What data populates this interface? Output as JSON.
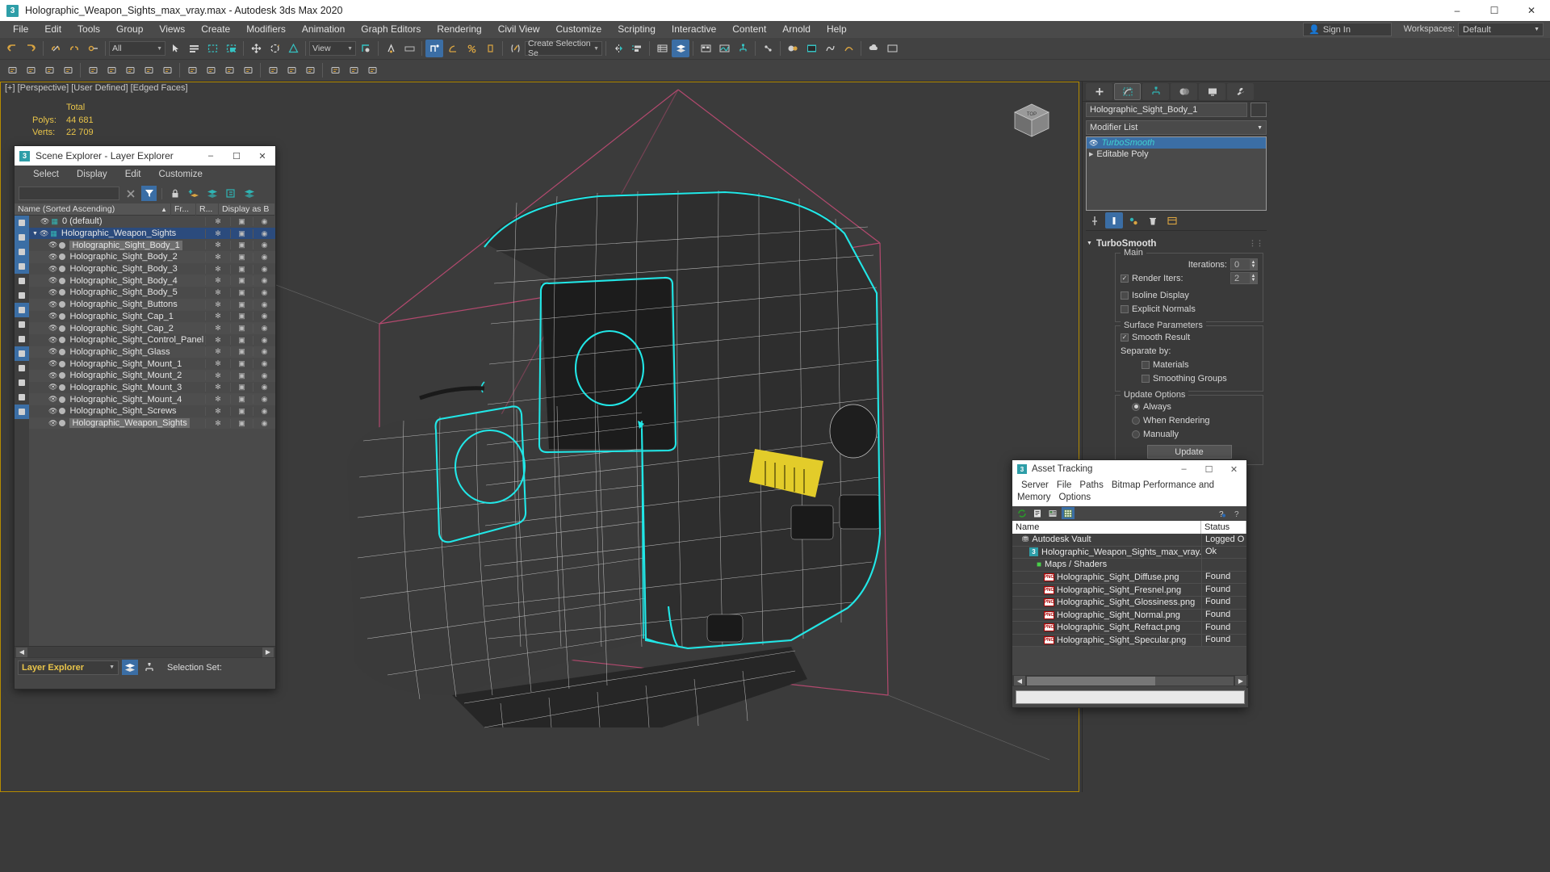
{
  "title_bar": {
    "logo": "max-logo-icon",
    "title": "Holographic_Weapon_Sights_max_vray.max - Autodesk 3ds Max 2020",
    "minimize": "–",
    "maximize": "☐",
    "close": "✕"
  },
  "menu_bar": {
    "items": [
      "File",
      "Edit",
      "Tools",
      "Group",
      "Views",
      "Create",
      "Modifiers",
      "Animation",
      "Graph Editors",
      "Rendering",
      "Civil View",
      "Customize",
      "Scripting",
      "Interactive",
      "Content",
      "Arnold",
      "Help"
    ],
    "sign_in": "Sign In",
    "workspaces_label": "Workspaces:",
    "workspace_value": "Default"
  },
  "toolbar": {
    "selection_filter": "All",
    "view_combo": "View",
    "named_selection_set": "Create Selection Se",
    "icons_row1": [
      "undo-icon",
      "redo-icon",
      "select-link-icon",
      "unlink-icon",
      "bind-space-warp-icon",
      "filter-combo",
      "select-object-icon",
      "select-by-name-icon",
      "rect-select-icon",
      "window-crossing-icon",
      "select-move-icon",
      "select-rotate-icon",
      "select-scale-icon",
      "ref-coord-combo",
      "use-pivot-center-icon",
      "select-and-manipulate-icon",
      "snap-toggle-icon",
      "angle-snap-icon",
      "percent-snap-icon",
      "spinner-snap-icon",
      "named-selection-icon",
      "mirror-icon",
      "align-icon",
      "layer-explorer-icon",
      "scene-explorer-icon",
      "ribbon-icon",
      "curve-editor-icon",
      "schematic-view-icon",
      "project-folder-icon",
      "material-editor-icon",
      "render-setup-icon",
      "render-frame-icon",
      "render-production-icon"
    ],
    "icons_row2": [
      "select-icon",
      "window-crossing-icon",
      "paint-select-icon",
      "named-sel-icon",
      "mirror-icon",
      "align-icon",
      "quick-align-icon",
      "spacing-icon",
      "clone-icon",
      "array-icon",
      "snapshot-icon",
      "normal-align-icon",
      "place-highlight-icon",
      "align-camera-icon",
      "align-view-icon",
      "quick-render-icon",
      "render-in-cloud-icon",
      "open-ui-icon",
      "help-icon"
    ]
  },
  "viewport": {
    "label": "[+] [Perspective] [User Defined] [Edged Faces]",
    "stats": {
      "header": "Total",
      "polys_label": "Polys:",
      "polys_value": "44 681",
      "verts_label": "Verts:",
      "verts_value": "22 709"
    },
    "viewcube": "view-cube-icon",
    "selection_highlight_color": "#21e7e7",
    "grid_color": "#c84c78",
    "model": "holographic-weapon-sight-3d-model"
  },
  "scene_explorer": {
    "window_title": "Scene Explorer - Layer Explorer",
    "logo": "max-logo-icon",
    "window_controls": {
      "minimize": "–",
      "maximize": "☐",
      "close": "✕"
    },
    "menus": [
      "Select",
      "Display",
      "Edit",
      "Customize"
    ],
    "search_value": "",
    "toolbar_icons": [
      "clear-search-icon",
      "filter-icon",
      "lock-icon",
      "add-layer-icon",
      "select-highlighted-layer-icon",
      "layer-hierarchy-icon",
      "layers-icon"
    ],
    "left_rail_icons": [
      "geometry-filter-icon",
      "shapes-filter-icon",
      "lights-filter-icon",
      "cameras-filter-icon",
      "helpers-filter-icon",
      "space-warps-filter-icon",
      "bones-filter-icon",
      "groups-filter-icon",
      "xrefs-filter-icon",
      "all-filter-icon",
      "particle-filter-icon",
      "freeze-filter-icon",
      "hidden-filter-icon",
      "visible-filter-icon"
    ],
    "columns": [
      {
        "label": "Name (Sorted Ascending)",
        "sort": "▲"
      },
      {
        "label": "Fr..."
      },
      {
        "label": "R..."
      },
      {
        "label": "Display as B"
      }
    ],
    "rows": [
      {
        "name": "0 (default)",
        "type": "layer",
        "depth": 1,
        "expander": "",
        "selected": false,
        "highlighted": false
      },
      {
        "name": "Holographic_Weapon_Sights",
        "type": "layer",
        "depth": 0,
        "expander": "▼",
        "selected": true,
        "highlighted": false
      },
      {
        "name": "Holographic_Sight_Body_1",
        "type": "object",
        "depth": 2,
        "expander": "",
        "selected": false,
        "highlighted": true
      },
      {
        "name": "Holographic_Sight_Body_2",
        "type": "object",
        "depth": 2,
        "expander": "",
        "selected": false,
        "highlighted": false
      },
      {
        "name": "Holographic_Sight_Body_3",
        "type": "object",
        "depth": 2,
        "expander": "",
        "selected": false,
        "highlighted": false
      },
      {
        "name": "Holographic_Sight_Body_4",
        "type": "object",
        "depth": 2,
        "expander": "",
        "selected": false,
        "highlighted": false
      },
      {
        "name": "Holographic_Sight_Body_5",
        "type": "object",
        "depth": 2,
        "expander": "",
        "selected": false,
        "highlighted": false
      },
      {
        "name": "Holographic_Sight_Buttons",
        "type": "object",
        "depth": 2,
        "expander": "",
        "selected": false,
        "highlighted": false
      },
      {
        "name": "Holographic_Sight_Cap_1",
        "type": "object",
        "depth": 2,
        "expander": "",
        "selected": false,
        "highlighted": false
      },
      {
        "name": "Holographic_Sight_Cap_2",
        "type": "object",
        "depth": 2,
        "expander": "",
        "selected": false,
        "highlighted": false
      },
      {
        "name": "Holographic_Sight_Control_Panel",
        "type": "object",
        "depth": 2,
        "expander": "",
        "selected": false,
        "highlighted": false
      },
      {
        "name": "Holographic_Sight_Glass",
        "type": "object",
        "depth": 2,
        "expander": "",
        "selected": false,
        "highlighted": false
      },
      {
        "name": "Holographic_Sight_Mount_1",
        "type": "object",
        "depth": 2,
        "expander": "",
        "selected": false,
        "highlighted": false
      },
      {
        "name": "Holographic_Sight_Mount_2",
        "type": "object",
        "depth": 2,
        "expander": "",
        "selected": false,
        "highlighted": false
      },
      {
        "name": "Holographic_Sight_Mount_3",
        "type": "object",
        "depth": 2,
        "expander": "",
        "selected": false,
        "highlighted": false
      },
      {
        "name": "Holographic_Sight_Mount_4",
        "type": "object",
        "depth": 2,
        "expander": "",
        "selected": false,
        "highlighted": false
      },
      {
        "name": "Holographic_Sight_Screws",
        "type": "object",
        "depth": 2,
        "expander": "",
        "selected": false,
        "highlighted": false
      },
      {
        "name": "Holographic_Weapon_Sights",
        "type": "object",
        "depth": 2,
        "expander": "",
        "selected": false,
        "highlighted": true
      }
    ],
    "status": {
      "combo_value": "Layer Explorer",
      "icons": [
        "layer-explorer-mode-icon",
        "scene-explorer-mode-icon"
      ],
      "selection_set_label": "Selection Set:"
    }
  },
  "command_panel": {
    "tabs": [
      "create-tab-icon",
      "modify-tab-icon",
      "hierarchy-tab-icon",
      "motion-tab-icon",
      "display-tab-icon",
      "utilities-tab-icon"
    ],
    "active_tab_index": 1,
    "object_name": "Holographic_Sight_Body_1",
    "modifier_list_label": "Modifier List",
    "modifier_stack": [
      {
        "name": "TurboSmooth",
        "active": true,
        "eye": "◉"
      },
      {
        "name": "Editable Poly",
        "active": false,
        "expander": "▶"
      }
    ],
    "stack_buttons": [
      "pin-stack-icon",
      "show-end-result-icon",
      "make-unique-icon",
      "remove-modifier-icon",
      "configure-sets-icon"
    ],
    "rollout": {
      "title": "TurboSmooth",
      "collapse": "▼",
      "main": {
        "group_label": "Main",
        "iterations_label": "Iterations:",
        "iterations_value": "0",
        "render_iters_label": "Render Iters:",
        "render_iters_value": "2",
        "render_iters_checked": true,
        "isoline_display_label": "Isoline Display",
        "isoline_display_checked": false,
        "explicit_normals_label": "Explicit Normals",
        "explicit_normals_checked": false
      },
      "surface_parameters": {
        "group_label": "Surface Parameters",
        "smooth_result_label": "Smooth Result",
        "smooth_result_checked": true,
        "separate_by_label": "Separate by:",
        "materials_label": "Materials",
        "materials_checked": false,
        "smoothing_groups_label": "Smoothing Groups",
        "smoothing_groups_checked": false
      },
      "update_options": {
        "group_label": "Update Options",
        "options": [
          {
            "label": "Always",
            "selected": true
          },
          {
            "label": "When Rendering",
            "selected": false
          },
          {
            "label": "Manually",
            "selected": false
          }
        ],
        "update_button": "Update"
      }
    }
  },
  "asset_tracking": {
    "window_title": "Asset Tracking",
    "logo": "max-logo-icon",
    "window_controls": {
      "minimize": "–",
      "maximize": "☐",
      "close": "✕"
    },
    "menus": [
      "Server",
      "File",
      "Paths",
      "Bitmap Performance and Memory",
      "Options"
    ],
    "toolbar_icons": [
      "refresh-icon",
      "list-view-icon",
      "details-view-icon",
      "grid-view-icon",
      "help-vault-icon",
      "help-icon"
    ],
    "columns": [
      "Name",
      "Status"
    ],
    "rows": [
      {
        "name": "Autodesk Vault",
        "status": "Logged O",
        "icon": "vault-icon",
        "depth": 1
      },
      {
        "name": "Holographic_Weapon_Sights_max_vray.max",
        "status": "Ok",
        "icon": "max-file-icon",
        "depth": 2
      },
      {
        "name": "Maps / Shaders",
        "status": "",
        "icon": "maps-shaders-icon",
        "depth": 3
      },
      {
        "name": "Holographic_Sight_Diffuse.png",
        "status": "Found",
        "icon": "png-icon",
        "depth": 4
      },
      {
        "name": "Holographic_Sight_Fresnel.png",
        "status": "Found",
        "icon": "png-icon",
        "depth": 4
      },
      {
        "name": "Holographic_Sight_Glossiness.png",
        "status": "Found",
        "icon": "png-icon",
        "depth": 4
      },
      {
        "name": "Holographic_Sight_Normal.png",
        "status": "Found",
        "icon": "png-icon",
        "depth": 4
      },
      {
        "name": "Holographic_Sight_Refract.png",
        "status": "Found",
        "icon": "png-icon",
        "depth": 4
      },
      {
        "name": "Holographic_Sight_Specular.png",
        "status": "Found",
        "icon": "png-icon",
        "depth": 4
      }
    ],
    "path_field_value": ""
  }
}
